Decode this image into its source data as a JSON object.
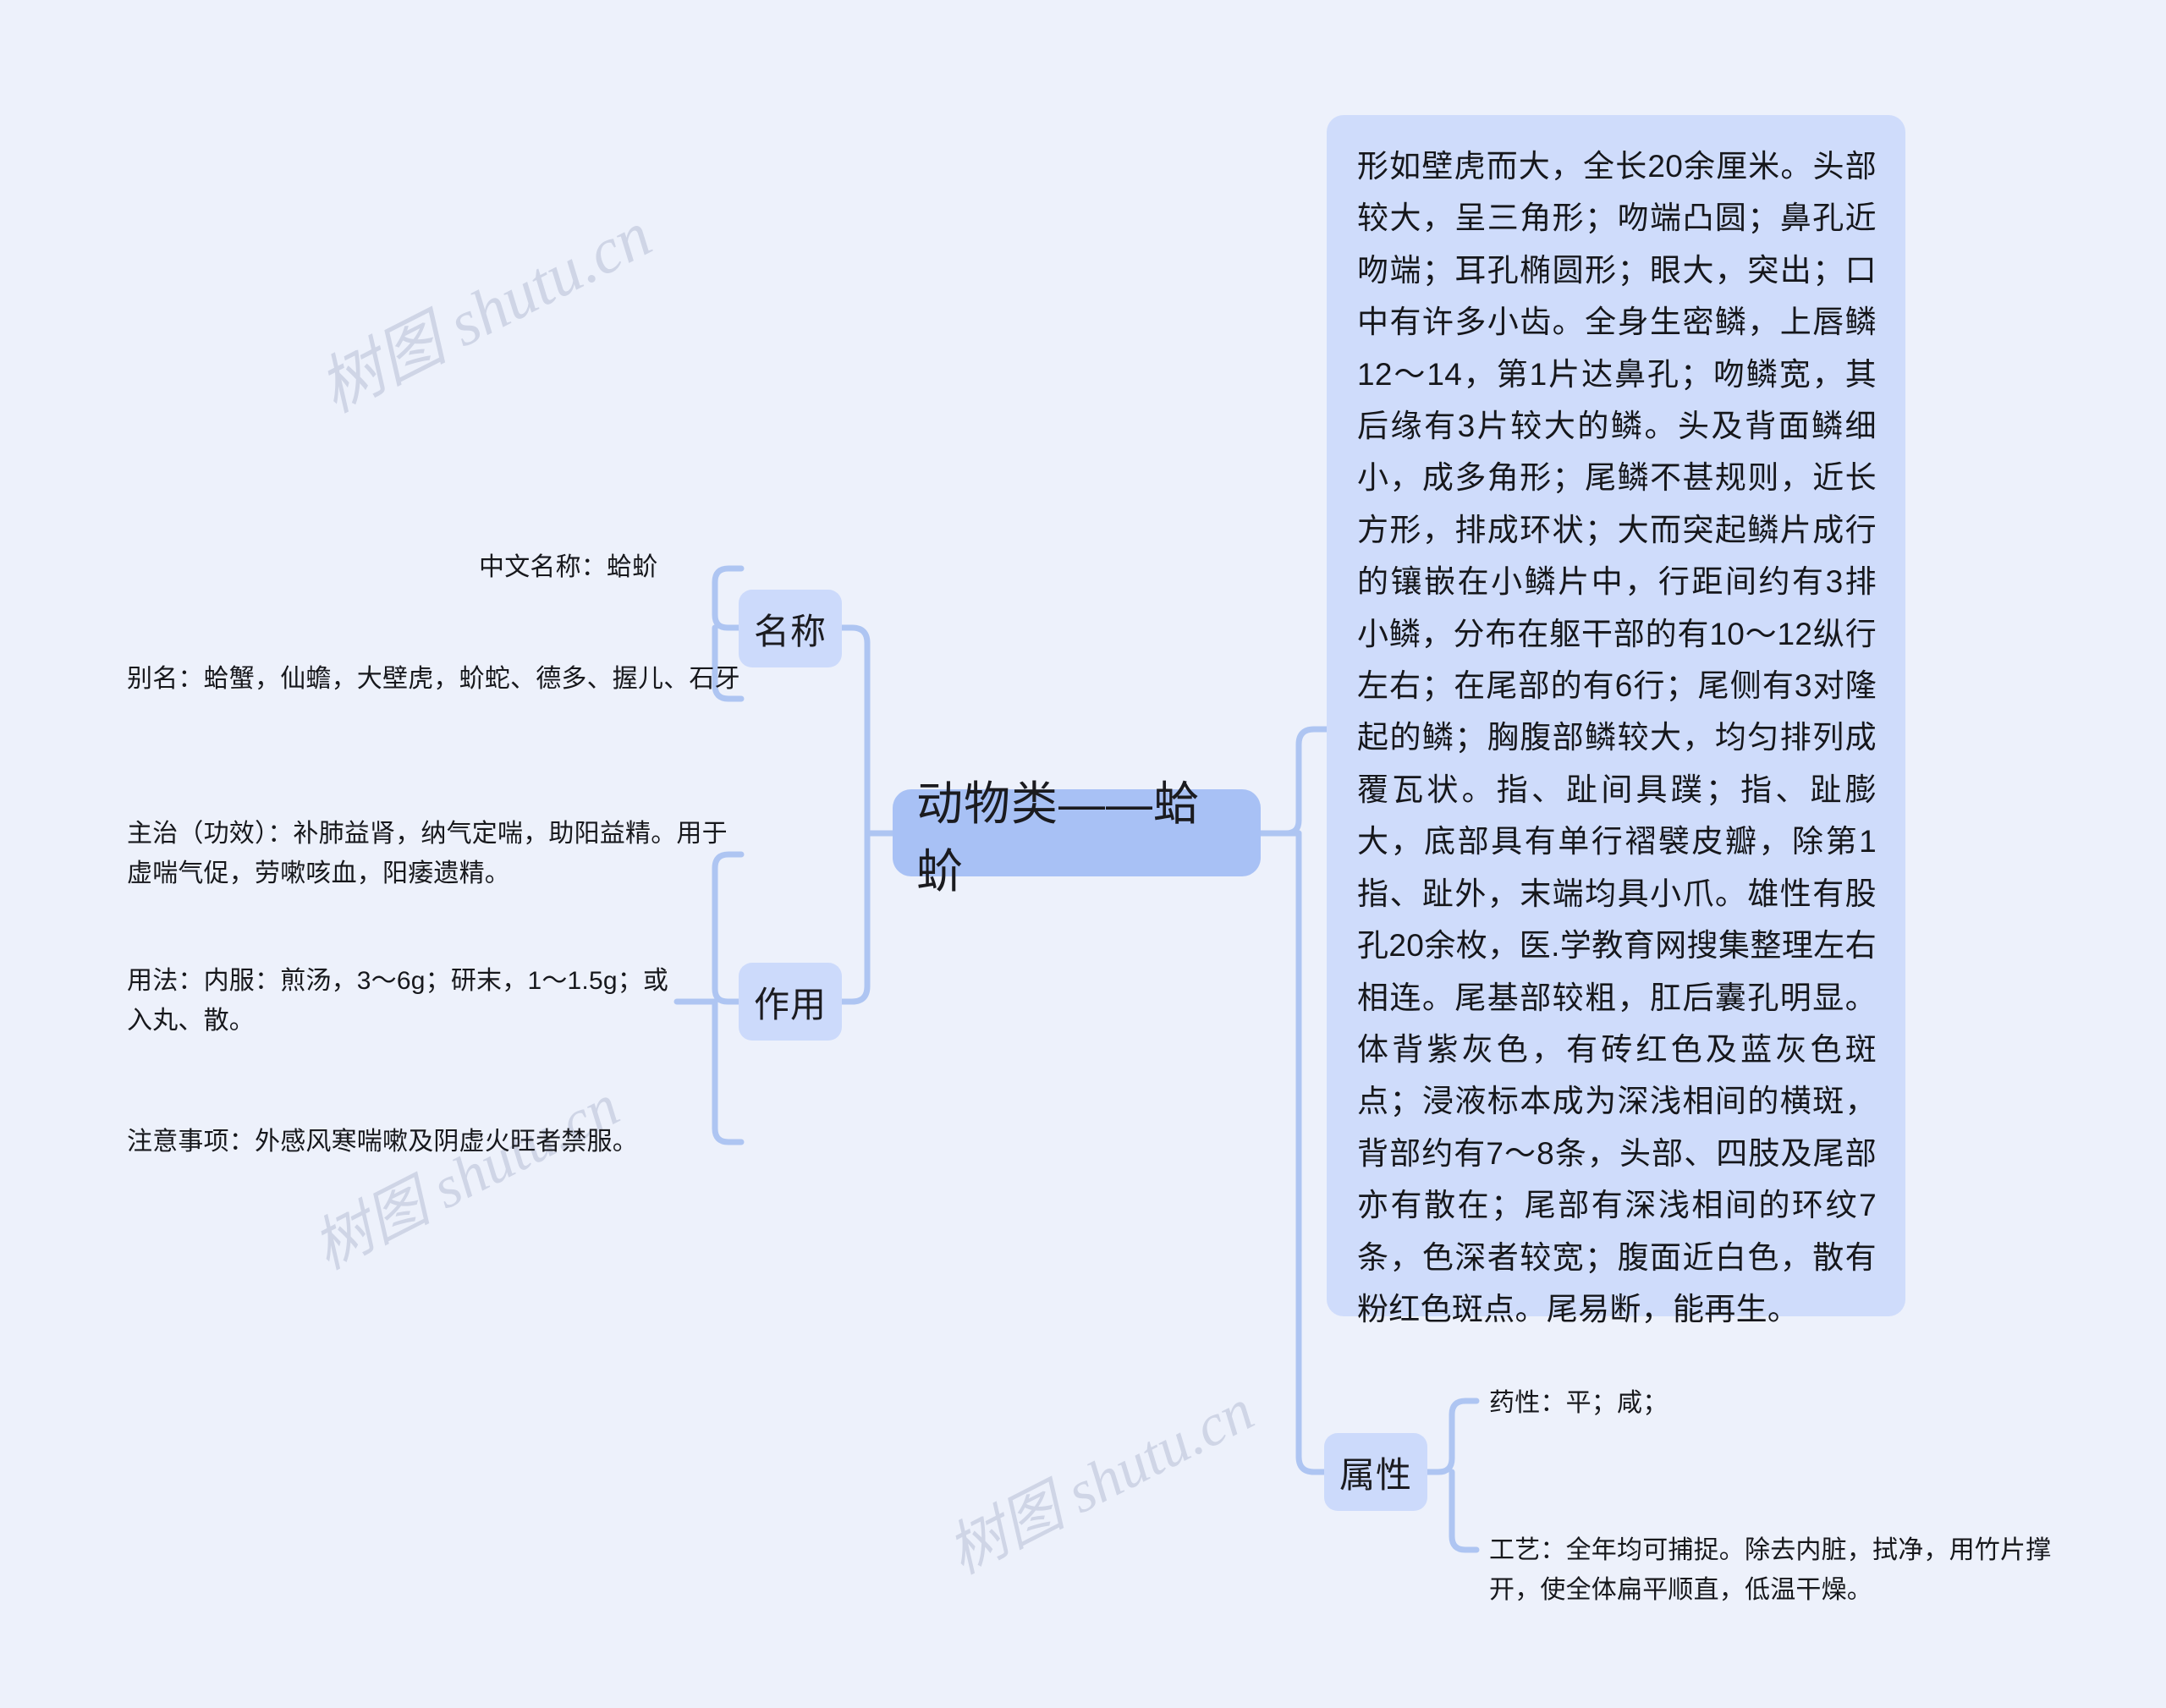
{
  "diagram": {
    "title": "动物类——蛤蚧",
    "type": "mindmap",
    "colors": {
      "background": "#edf1fb",
      "root_fill": "#a8c1f5",
      "branch_fill": "#ccdafb",
      "descbox_fill": "#cfdcfb",
      "connector": "#aec5f2",
      "text": "#17181c",
      "watermark": "#c4cbdf"
    }
  },
  "root": {
    "label": "动物类——蛤蚧"
  },
  "branches": {
    "name": {
      "label": "名称",
      "items": [
        {
          "text": "中文名称：蛤蚧"
        },
        {
          "text": "别名：蛤蟹，仙蟾，大壁虎，蚧蛇、德多、握儿、石牙"
        }
      ]
    },
    "effect": {
      "label": "作用",
      "items": [
        {
          "text": "主治（功效）：补肺益肾，纳气定喘，助阳益精。用于虚喘气促，劳嗽咳血，阳痿遗精。"
        },
        {
          "text": "用法：内服：煎汤，3～6g；研末，1～1.5g；或入丸、散。"
        },
        {
          "text": "注意事项：外感风寒喘嗽及阴虚火旺者禁服。"
        }
      ]
    },
    "attributes": {
      "label": "属性",
      "items": [
        {
          "text": "药性：平；咸；"
        },
        {
          "text": "工艺：全年均可捕捉。除去内脏，拭净，用竹片撑开，使全体扁平顺直，低温干燥。"
        }
      ]
    }
  },
  "description": {
    "text": "形如壁虎而大，全长20余厘米。头部较大，呈三角形；吻端凸圆；鼻孔近吻端；耳孔椭圆形；眼大，突出；口中有许多小齿。全身生密鳞，上唇鳞12～14，第1片达鼻孔；吻鳞宽，其后缘有3片较大的鳞。头及背面鳞细小，成多角形；尾鳞不甚规则，近长方形，排成环状；大而突起鳞片成行的镶嵌在小鳞片中，行距间约有3排小鳞，分布在躯干部的有10～12纵行左右；在尾部的有6行；尾侧有3对隆起的鳞；胸腹部鳞较大，均匀排列成覆瓦状。指、趾间具蹼；指、趾膨大，底部具有单行褶襞皮瓣，除第1指、趾外，末端均具小爪。雄性有股孔20余枚，医.学教育网搜集整理左右相连。尾基部较粗，肛后囊孔明显。体背紫灰色，有砖红色及蓝灰色斑点；浸液标本成为深浅相间的横斑，背部约有7～8条，头部、四肢及尾部亦有散在；尾部有深浅相间的环纹7条，色深者较宽；腹面近白色，散有粉红色斑点。尾易断，能再生。"
  },
  "watermarks": [
    {
      "text": "树图 shutu.cn"
    },
    {
      "text": "树图 shutu.cn"
    },
    {
      "text": "树图 shutu.cn"
    },
    {
      "text": "树图 shutu.cn"
    },
    {
      "text": "树图 shutu.cn"
    }
  ]
}
